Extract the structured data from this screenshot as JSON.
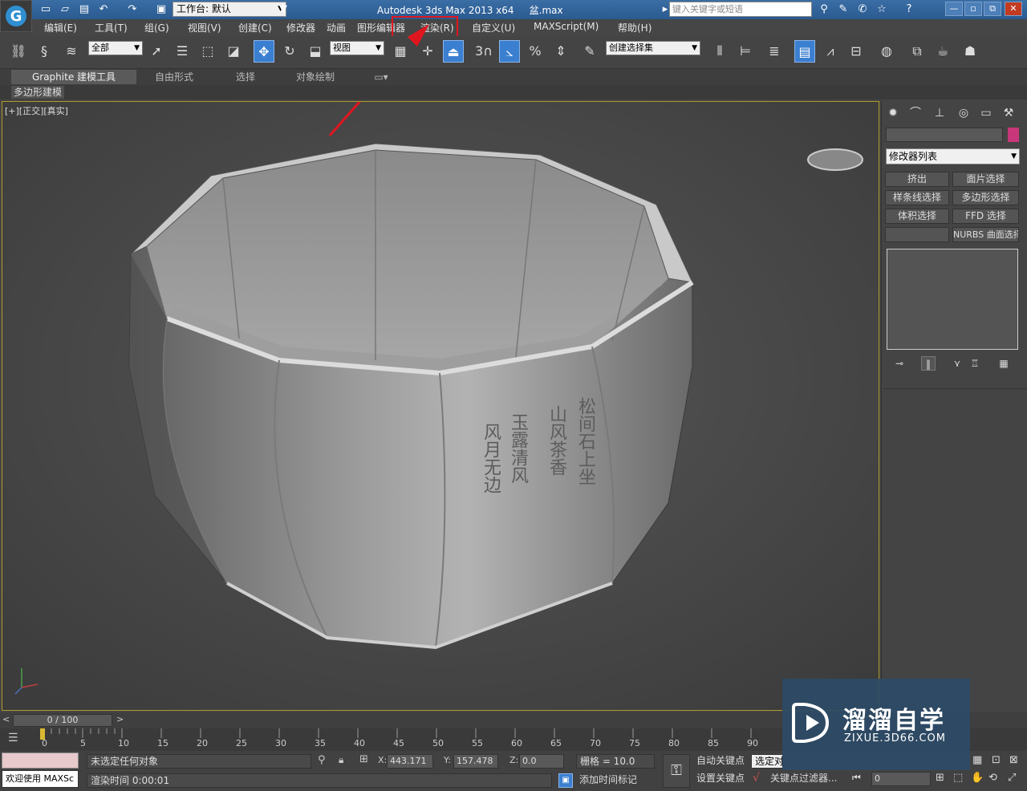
{
  "titlebar": {
    "workspace_label": "工作台: 默认",
    "app_title": "Autodesk 3ds Max  2013 x64",
    "file_name": "盆.max",
    "search_placeholder": "键入关键字或短语",
    "help_label": "?"
  },
  "menubar": {
    "items": [
      "编辑(E)",
      "工具(T)",
      "组(G)",
      "视图(V)",
      "创建(C)",
      "修改器",
      "动画",
      "图形编辑器",
      "渲染(R)",
      "自定义(U)",
      "MAXScript(M)",
      "帮助(H)"
    ],
    "highlighted": "渲染(R)",
    "highlight_color": "#e0161f"
  },
  "toolbar": {
    "selection_filter": "全部",
    "ref_coord": "视图",
    "named_selection": "创建选择集",
    "snap_number": "3",
    "percent_snap": "%"
  },
  "ribbon": {
    "tabs": [
      "Graphite 建模工具",
      "自由形式",
      "选择",
      "对象绘制"
    ],
    "panel_label": "多边形建模"
  },
  "viewport": {
    "label": "[+][正交][真实]",
    "inscription": [
      "松间石上坐",
      "山风茶香",
      "玉露清风",
      "风月无边"
    ],
    "annotation_color": "#e0161f"
  },
  "command_panel": {
    "modifier_list": "修改器列表",
    "object_color": "#c8377a",
    "buttons": [
      "挤出",
      "面片选择",
      "样条线选择",
      "多边形选择",
      "体积选择",
      "FFD 选择",
      "",
      "NURBS 曲面选择"
    ]
  },
  "timeline": {
    "frame_display": "0 / 100",
    "ticks": [
      "0",
      "5",
      "10",
      "15",
      "20",
      "25",
      "30",
      "35",
      "40",
      "45",
      "50",
      "55",
      "60",
      "65",
      "70",
      "75",
      "80",
      "85",
      "90"
    ]
  },
  "statusbar": {
    "welcome": "欢迎使用 MAXSc",
    "selection_status": "未选定任何对象",
    "render_time": "渲染时间  0:00:01",
    "x_label": "X:",
    "x_value": "443.171",
    "y_label": "Y:",
    "y_value": "157.478",
    "z_label": "Z:",
    "z_value": "0.0",
    "grid": "栅格 = 10.0",
    "add_time_tag": "添加时间标记",
    "auto_key": "自动关键点",
    "set_key": "设置关键点",
    "selected_dropdown": "选定对",
    "key_filters": "关键点过滤器...",
    "frame_value": "0"
  },
  "watermark": {
    "brand": "溜溜自学",
    "url": "ZIXUE.3D66.COM"
  }
}
